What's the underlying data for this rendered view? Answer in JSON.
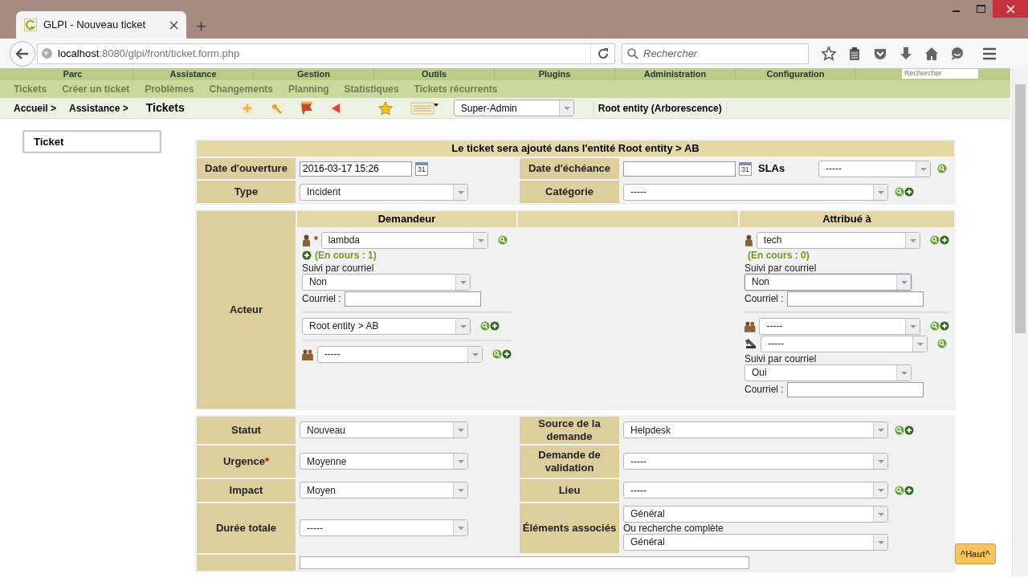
{
  "browser": {
    "tab_title": "GLPI - Nouveau ticket",
    "new_tab": "+",
    "url_host": "localhost",
    "url_rest": ":8080/glpi/front/ticket.form.php",
    "search_placeholder": "Rechercher"
  },
  "main_menu": [
    "Parc",
    "Assistance",
    "Gestion",
    "Outils",
    "Plugins",
    "Administration",
    "Configuration"
  ],
  "menu_search": {
    "placeholder": "Rechercher"
  },
  "sub_menu": [
    "Tickets",
    "Créer un ticket",
    "Problèmes",
    "Changements",
    "Planning",
    "Statistiques",
    "Tickets récurrents"
  ],
  "breadcrumb": {
    "items": [
      "Accueil >",
      "Assistance >"
    ],
    "current": "Tickets",
    "profile": "Super-Admin",
    "entity": "Root entity (Arborescence)"
  },
  "side_tabs": [
    {
      "label": "Ticket",
      "selected": true
    }
  ],
  "form": {
    "title": "Le ticket sera ajouté dans l'entité Root entity > AB",
    "opening_date": {
      "label": "Date d'ouverture",
      "value": "2016-03-17 15:26",
      "calendar": "31"
    },
    "due_date": {
      "label": "Date d'échéance",
      "calendar": "31"
    },
    "slas": {
      "label": "SLAs",
      "value": "-----",
      "buttons": [
        {
          "kind": "search"
        }
      ]
    },
    "type": {
      "label": "Type",
      "value": "Incident"
    },
    "category": {
      "label": "Catégorie",
      "value": "-----",
      "buttons": [
        {
          "kind": "search"
        },
        {
          "kind": "add"
        }
      ]
    },
    "actor": {
      "label": "Acteur",
      "requester": {
        "heading": "Demandeur",
        "user": "lambda",
        "required_mark": "*",
        "buttons": [
          {
            "kind": "search"
          }
        ],
        "count": "(En cours : 1)",
        "count_buttons": [
          {
            "kind": "add"
          }
        ],
        "follow_label": "Suivi par courriel",
        "follow": "Non",
        "follow_focused": false,
        "email_label": "Courriel :",
        "entity": "Root entity > AB",
        "entity_buttons": [
          {
            "kind": "search"
          },
          {
            "kind": "add"
          }
        ],
        "group": "-----",
        "group_buttons": [
          {
            "kind": "search"
          },
          {
            "kind": "add"
          }
        ]
      },
      "assigned": {
        "heading": "Attribué à",
        "user": "tech",
        "buttons": [
          {
            "kind": "search"
          },
          {
            "kind": "add"
          }
        ],
        "count": "(En cours : 0)",
        "follow_label": "Suivi par courriel",
        "follow": "Non",
        "follow_focused": true,
        "email_label": "Courriel :",
        "group": "-----",
        "group_buttons": [
          {
            "kind": "search"
          },
          {
            "kind": "add"
          }
        ],
        "supplier": "-----",
        "supplier_buttons": [
          {
            "kind": "search"
          }
        ],
        "supplier_follow_label": "Suivi par courriel",
        "supplier_follow": "Oui",
        "supplier_email_label": "Courriel :"
      }
    },
    "left_fields": [
      {
        "label": "Statut",
        "value": "Nouveau"
      },
      {
        "label": "Urgence",
        "required_mark": "*",
        "value": "Moyenne"
      },
      {
        "label": "Impact",
        "value": "Moyen"
      },
      {
        "label": "Durée totale",
        "value": "-----"
      }
    ],
    "right_fields": [
      {
        "label": "Source de la demande",
        "value": "Helpdesk",
        "buttons": [
          {
            "kind": "search"
          },
          {
            "kind": "add"
          }
        ]
      },
      {
        "label": "Demande de validation",
        "value": "-----"
      },
      {
        "label": "Lieu",
        "value": "-----",
        "buttons": [
          {
            "kind": "search"
          },
          {
            "kind": "add"
          }
        ]
      },
      {
        "label": "Éléments associés",
        "value": "Général",
        "note": "Ou recherche complète",
        "value2": "Général"
      }
    ]
  },
  "back_to_top": "^Haut^"
}
